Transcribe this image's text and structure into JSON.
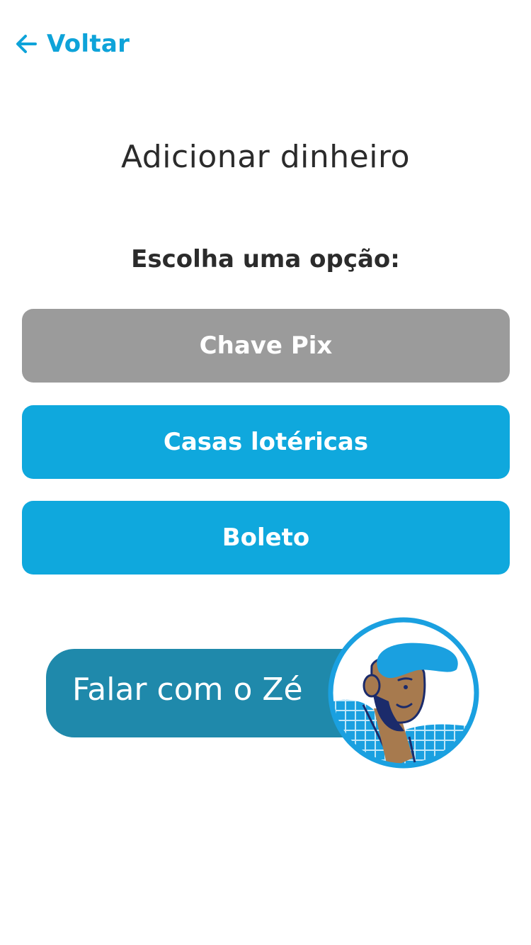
{
  "header": {
    "back_label": "Voltar",
    "back_icon": "arrow-left-icon"
  },
  "main": {
    "title": "Adicionar dinheiro",
    "subtitle": "Escolha uma opção:",
    "options": [
      {
        "label": "Chave Pix",
        "state": "disabled"
      },
      {
        "label": "Casas lotéricas",
        "state": "enabled"
      },
      {
        "label": "Boleto",
        "state": "enabled"
      }
    ]
  },
  "chat": {
    "label": "Falar com o Zé",
    "avatar_icon": "ze-avatar-icon"
  },
  "colors": {
    "accent": "#0fa8dd",
    "disabled": "#9b9b9b",
    "chat_pill": "#1f89ab",
    "text": "#2b2b2b"
  }
}
